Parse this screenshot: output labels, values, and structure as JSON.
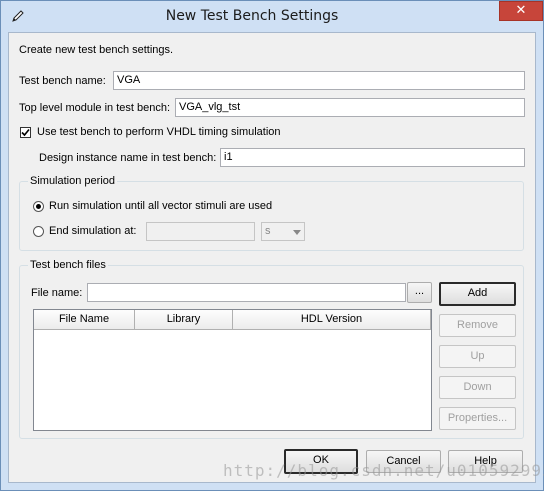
{
  "window": {
    "title": "New Test Bench Settings",
    "close_glyph": "✕"
  },
  "intro": "Create new test bench settings.",
  "fields": {
    "test_bench_name": {
      "label": "Test bench name:",
      "value": "VGA"
    },
    "top_level_module": {
      "label": "Top level module in test bench:",
      "value": "VGA_vlg_tst"
    },
    "timing_sim": {
      "label": "Use test bench to perform VHDL timing simulation",
      "checked": true
    },
    "design_instance": {
      "label": "Design instance name in test bench:",
      "value": "i1"
    }
  },
  "simulation_period": {
    "title": "Simulation period",
    "run_all_label": "Run simulation until all vector stimuli are used",
    "end_at_label": "End simulation at:",
    "end_at_value": "",
    "unit": "s"
  },
  "files": {
    "title": "Test bench files",
    "file_name_label": "File name:",
    "file_name_value": "",
    "browse_label": "...",
    "columns": [
      "File Name",
      "Library",
      "HDL Version"
    ],
    "rows": [],
    "buttons": {
      "add": "Add",
      "remove": "Remove",
      "up": "Up",
      "down": "Down",
      "properties": "Properties..."
    }
  },
  "footer": {
    "ok": "OK",
    "cancel": "Cancel",
    "help": "Help"
  },
  "watermark": "http://blog.csdn.net/u010592995"
}
